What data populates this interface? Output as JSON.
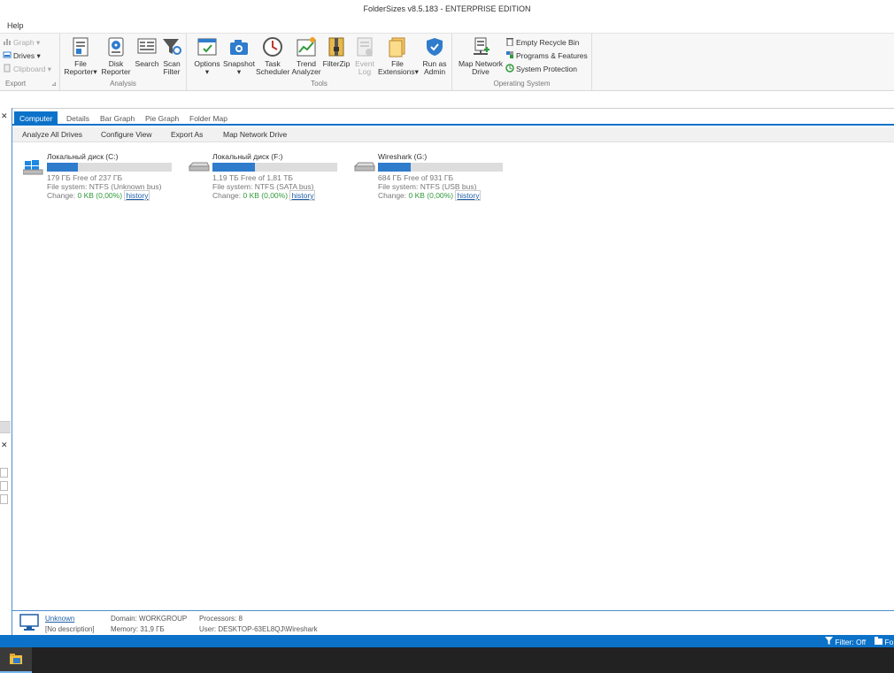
{
  "window": {
    "title": "FolderSizes v8.5.183 - ENTERPRISE EDITION"
  },
  "menu": {
    "items": [
      "Help"
    ]
  },
  "ribbon": {
    "export": {
      "label": "Export",
      "items": [
        {
          "label": "Graph",
          "icon": "graph-icon",
          "enabled": false
        },
        {
          "label": "Drives",
          "icon": "drives-icon",
          "enabled": true
        },
        {
          "label": "Clipboard",
          "icon": "clipboard-icon",
          "enabled": false
        }
      ]
    },
    "analysis": {
      "label": "Analysis",
      "items": [
        {
          "label1": "File",
          "label2": "Reporter",
          "icon": "file-reporter-icon"
        },
        {
          "label1": "Disk",
          "label2": "Reporter",
          "icon": "disk-reporter-icon"
        },
        {
          "label1": "Search",
          "label2": "",
          "icon": "search-icon"
        },
        {
          "label1": "Scan",
          "label2": "Filter",
          "icon": "scan-filter-icon"
        }
      ]
    },
    "tools": {
      "label": "Tools",
      "items": [
        {
          "label1": "Options",
          "label2": "",
          "icon": "options-icon",
          "enabled": true
        },
        {
          "label1": "Snapshot",
          "label2": "",
          "icon": "snapshot-icon",
          "enabled": true
        },
        {
          "label1": "Task",
          "label2": "Scheduler",
          "icon": "task-scheduler-icon",
          "enabled": true
        },
        {
          "label1": "Trend",
          "label2": "Analyzer",
          "icon": "trend-analyzer-icon",
          "enabled": true
        },
        {
          "label1": "FilterZip",
          "label2": "",
          "icon": "filterzip-icon",
          "enabled": true
        },
        {
          "label1": "Event",
          "label2": "Log",
          "icon": "event-log-icon",
          "enabled": false
        },
        {
          "label1": "File",
          "label2": "Extensions",
          "icon": "file-extensions-icon",
          "enabled": true
        },
        {
          "label1": "Run as",
          "label2": "Admin",
          "icon": "run-as-admin-icon",
          "enabled": true
        }
      ]
    },
    "os": {
      "label": "Operating System",
      "map_label1": "Map Network",
      "map_label2": "Drive",
      "items": [
        {
          "label": "Empty Recycle Bin",
          "icon": "recycle-bin-icon"
        },
        {
          "label": "Programs & Features",
          "icon": "programs-features-icon"
        },
        {
          "label": "System Protection",
          "icon": "system-protection-icon"
        }
      ]
    }
  },
  "tabs": [
    "Computer",
    "Details",
    "Bar Graph",
    "Pie Graph",
    "Folder Map"
  ],
  "active_tab": "Computer",
  "toolbar": [
    "Analyze All Drives",
    "Configure View",
    "Export As",
    "Map Network Drive"
  ],
  "drives": [
    {
      "name": "Локальный диск (C:)",
      "free": "179 ГБ Free of 237 ГБ",
      "fs": "File system: NTFS (Unknown bus)",
      "change_prefix": "Change: ",
      "change": "0 KB (0,00%)",
      "history": "history",
      "used_fraction": 0.245,
      "icon": "windows-drive-icon"
    },
    {
      "name": "Локальный диск (F:)",
      "free": "1,19 ТБ Free of 1,81 ТБ",
      "fs": "File system: NTFS (SATA bus)",
      "change_prefix": "Change: ",
      "change": "0 KB (0,00%)",
      "history": "history",
      "used_fraction": 0.34,
      "icon": "hard-drive-icon"
    },
    {
      "name": "Wireshark (G:)",
      "free": "684 ГБ Free of 931 ГБ",
      "fs": "File system: NTFS (USB bus)",
      "change_prefix": "Change: ",
      "change": "0 KB (0,00%)",
      "history": "history",
      "used_fraction": 0.265,
      "icon": "usb-drive-icon"
    }
  ],
  "computer": {
    "name": "Unknown",
    "description": "[No description]",
    "domain": "Domain: WORKGROUP",
    "memory": "Memory: 31,9 ГБ",
    "processors": "Processors: 8",
    "user": "User: DESKTOP-63EL8QJ\\Wireshark"
  },
  "status": {
    "filter": "Filter: Off",
    "right_cut": "Fo"
  },
  "colors": {
    "accent": "#0c72c9",
    "bar_fill": "#2f7ccc",
    "change_green": "#2f9a3a"
  }
}
